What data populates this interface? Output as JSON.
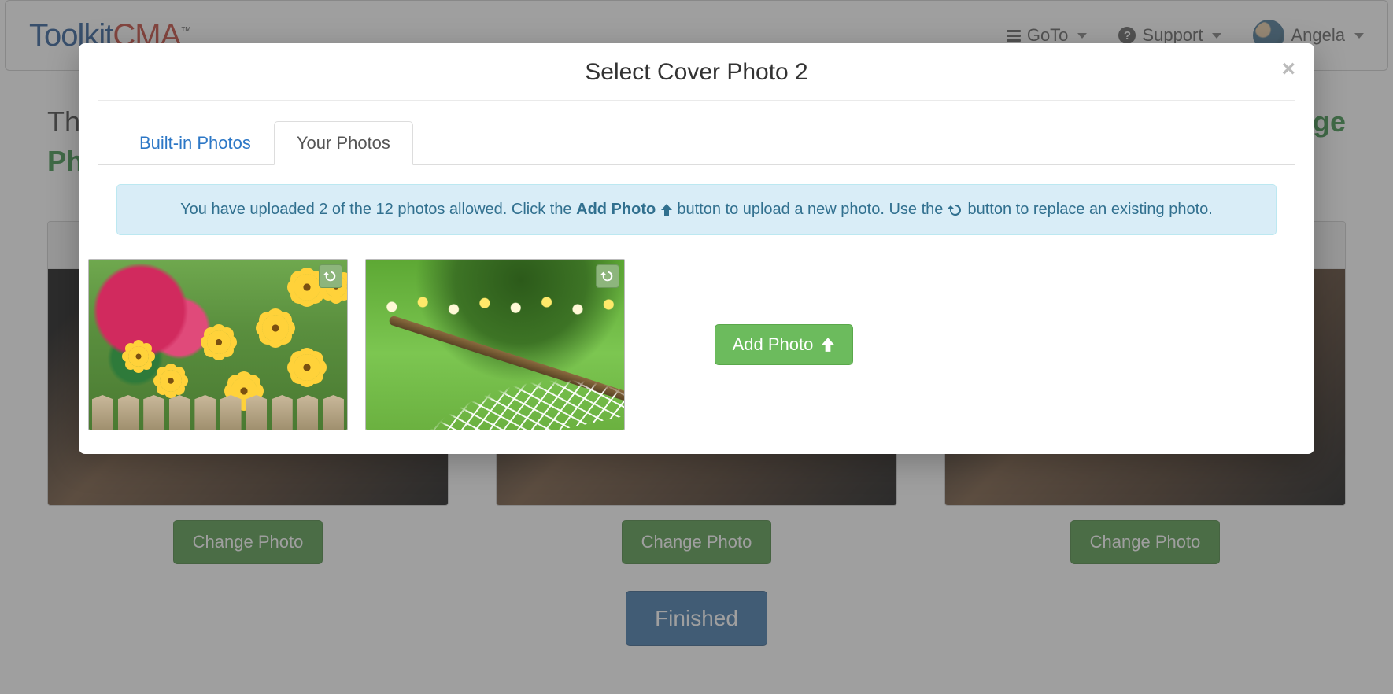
{
  "brand": {
    "part1": "Toolkit",
    "part2": "CMA",
    "tm": "™"
  },
  "nav": {
    "goto": "GoTo",
    "support": "Support",
    "user": "Angela"
  },
  "page": {
    "heading_prefix": "The",
    "heading_suffix_right": "ge",
    "heading_line2_green": "Ph"
  },
  "covers": {
    "change_label": "Change Photo"
  },
  "finished_label": "Finished",
  "modal": {
    "title": "Select Cover Photo 2",
    "close": "×",
    "tabs": {
      "builtin": "Built-in Photos",
      "your": "Your Photos"
    },
    "info": {
      "pre": "You have uploaded 2 of the 12 photos allowed. Click the ",
      "add_bold": "Add Photo",
      "mid": " button to upload a new photo. Use the ",
      "post": " button to replace an existing photo."
    },
    "add_photo": "Add Photo"
  }
}
